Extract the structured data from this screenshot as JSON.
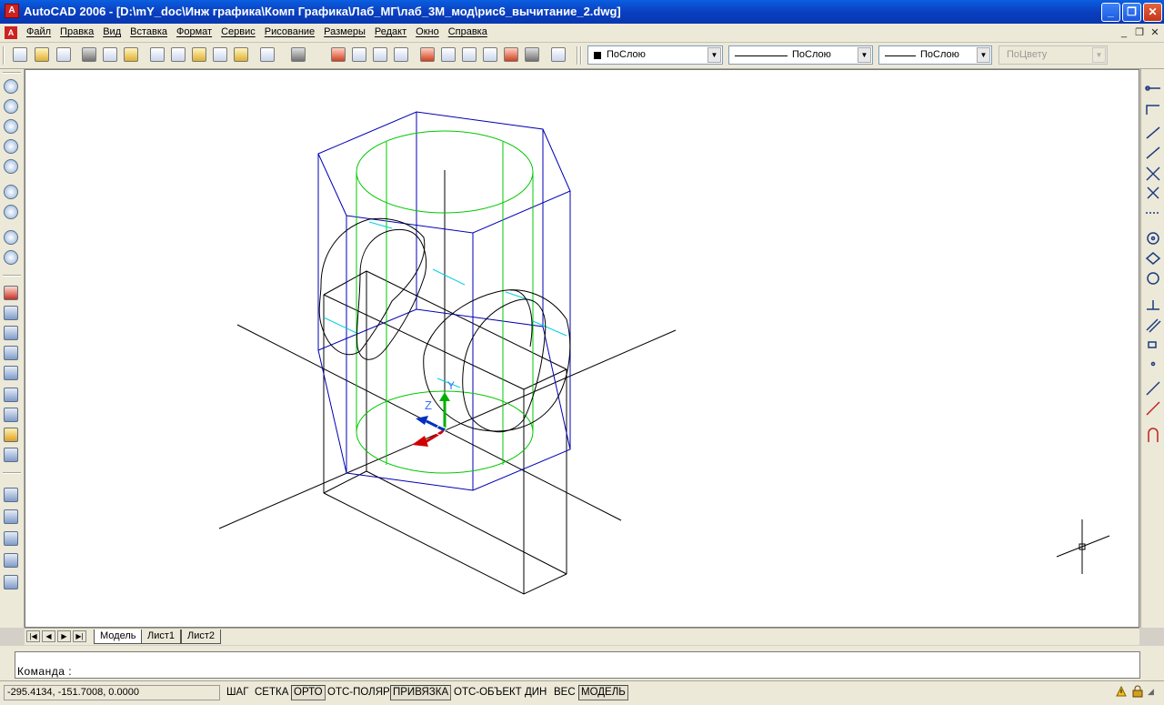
{
  "window": {
    "title": "AutoCAD 2006 - [D:\\mY_doc\\Инж графика\\Комп Графика\\Лаб_МГ\\лаб_3М_мод\\рис6_вычитание_2.dwg]",
    "minimize": "_",
    "maximize": "❐",
    "close": "✕"
  },
  "menu": [
    "Файл",
    "Правка",
    "Вид",
    "Вставка",
    "Формат",
    "Сервис",
    "Рисование",
    "Размеры",
    "Редакт",
    "Окно",
    "Справка"
  ],
  "mdi": {
    "minimize": "_",
    "restore": "❐",
    "close": "✕"
  },
  "properties": {
    "color": "ПоСлою",
    "linetype": "ПоСлою",
    "lineweight": "ПоСлою",
    "plotstyle": "ПоЦвету"
  },
  "ucs": {
    "z": "Z",
    "y": "Y"
  },
  "tabs": [
    "Модель",
    "Лист1",
    "Лист2"
  ],
  "active_tab": "Модель",
  "command": {
    "prompt": "Команда :"
  },
  "status": {
    "coordinates": "-295.4134, -151.7008, 0.0000",
    "buttons": [
      {
        "label": "ШАГ",
        "on": false
      },
      {
        "label": "СЕТКА",
        "on": false
      },
      {
        "label": "ОРТО",
        "on": true
      },
      {
        "label": "ОТС-ПОЛЯР",
        "on": false
      },
      {
        "label": "ПРИВЯЗКА",
        "on": true
      },
      {
        "label": "ОТС-ОБЪЕКТ",
        "on": false
      },
      {
        "label": "ДИН",
        "on": false
      },
      {
        "label": "ВЕС",
        "on": false
      },
      {
        "label": "МОДЕЛЬ",
        "on": true
      }
    ]
  },
  "colors": {
    "blue_edges": "#0000b4",
    "green_cylinder": "#00c800",
    "cyan": "#00d0e0",
    "black_lines": "#000000"
  }
}
